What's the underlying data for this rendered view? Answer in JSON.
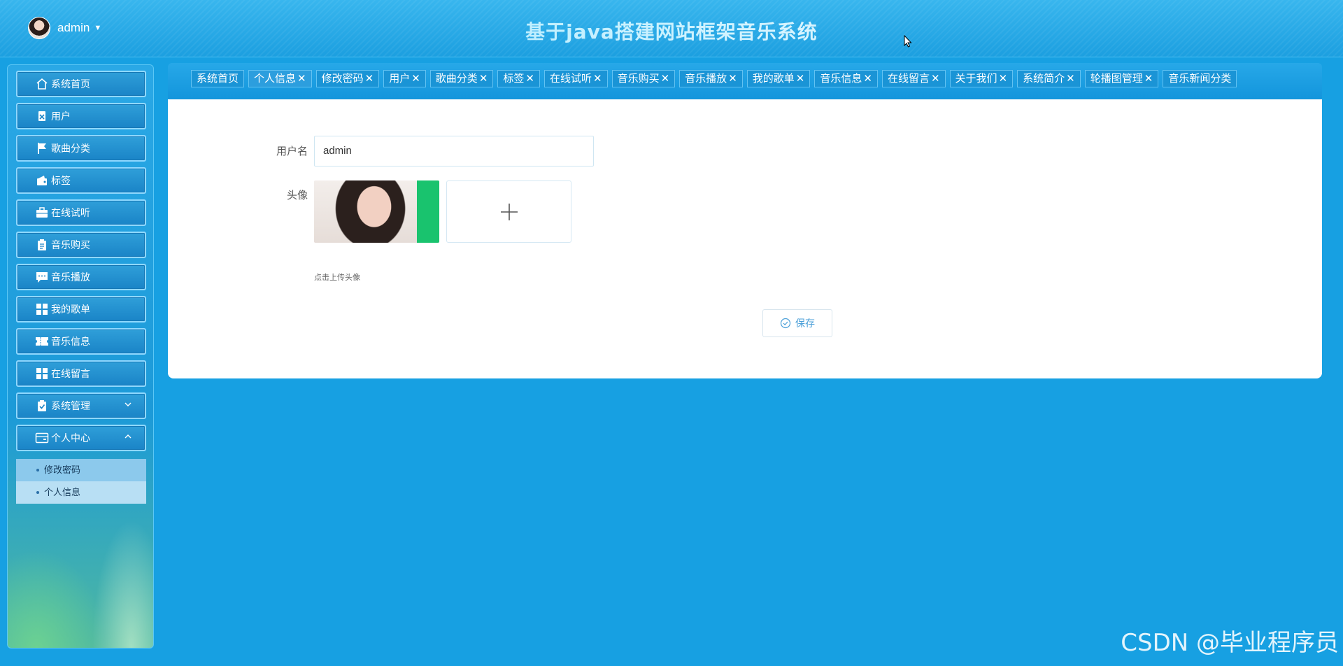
{
  "header": {
    "user_name": "admin",
    "caret": "▼",
    "site_title": "基于java搭建网站框架音乐系统"
  },
  "sidebar": {
    "items": [
      {
        "label": "系统首页",
        "icon": "home-icon"
      },
      {
        "label": "用户",
        "icon": "user-badge-icon"
      },
      {
        "label": "歌曲分类",
        "icon": "flag-icon"
      },
      {
        "label": "标签",
        "icon": "wallet-icon"
      },
      {
        "label": "在线试听",
        "icon": "briefcase-icon"
      },
      {
        "label": "音乐购买",
        "icon": "clipboard-icon"
      },
      {
        "label": "音乐播放",
        "icon": "chat-icon"
      },
      {
        "label": "我的歌单",
        "icon": "grid-icon"
      },
      {
        "label": "音乐信息",
        "icon": "ticket-icon"
      },
      {
        "label": "在线留言",
        "icon": "grid-icon"
      },
      {
        "label": "系统管理",
        "icon": "checklist-icon"
      },
      {
        "label": "个人中心",
        "icon": "card-icon"
      }
    ],
    "submenu": [
      "修改密码",
      "个人信息"
    ]
  },
  "tabs": [
    {
      "label": "系统首页",
      "closable": false
    },
    {
      "label": "个人信息",
      "closable": true,
      "active": true
    },
    {
      "label": "修改密码",
      "closable": true
    },
    {
      "label": "用户",
      "closable": true
    },
    {
      "label": "歌曲分类",
      "closable": true
    },
    {
      "label": "标签",
      "closable": true
    },
    {
      "label": "在线试听",
      "closable": true
    },
    {
      "label": "音乐购买",
      "closable": true
    },
    {
      "label": "音乐播放",
      "closable": true
    },
    {
      "label": "我的歌单",
      "closable": true
    },
    {
      "label": "音乐信息",
      "closable": true
    },
    {
      "label": "在线留言",
      "closable": true
    },
    {
      "label": "关于我们",
      "closable": true
    },
    {
      "label": "系统简介",
      "closable": true
    },
    {
      "label": "轮播图管理",
      "closable": true
    },
    {
      "label": "音乐新闻分类",
      "closable": false
    }
  ],
  "tab_close_glyph": "✕",
  "form": {
    "username_label": "用户名",
    "username_value": "admin",
    "avatar_label": "头像",
    "upload_hint": "点击上传头像",
    "save_label": "保存"
  },
  "watermark": "CSDN @毕业程序员",
  "colors": {
    "background": "#17a0e2",
    "header": "#2aaae8",
    "accent": "#4a9fd8"
  }
}
